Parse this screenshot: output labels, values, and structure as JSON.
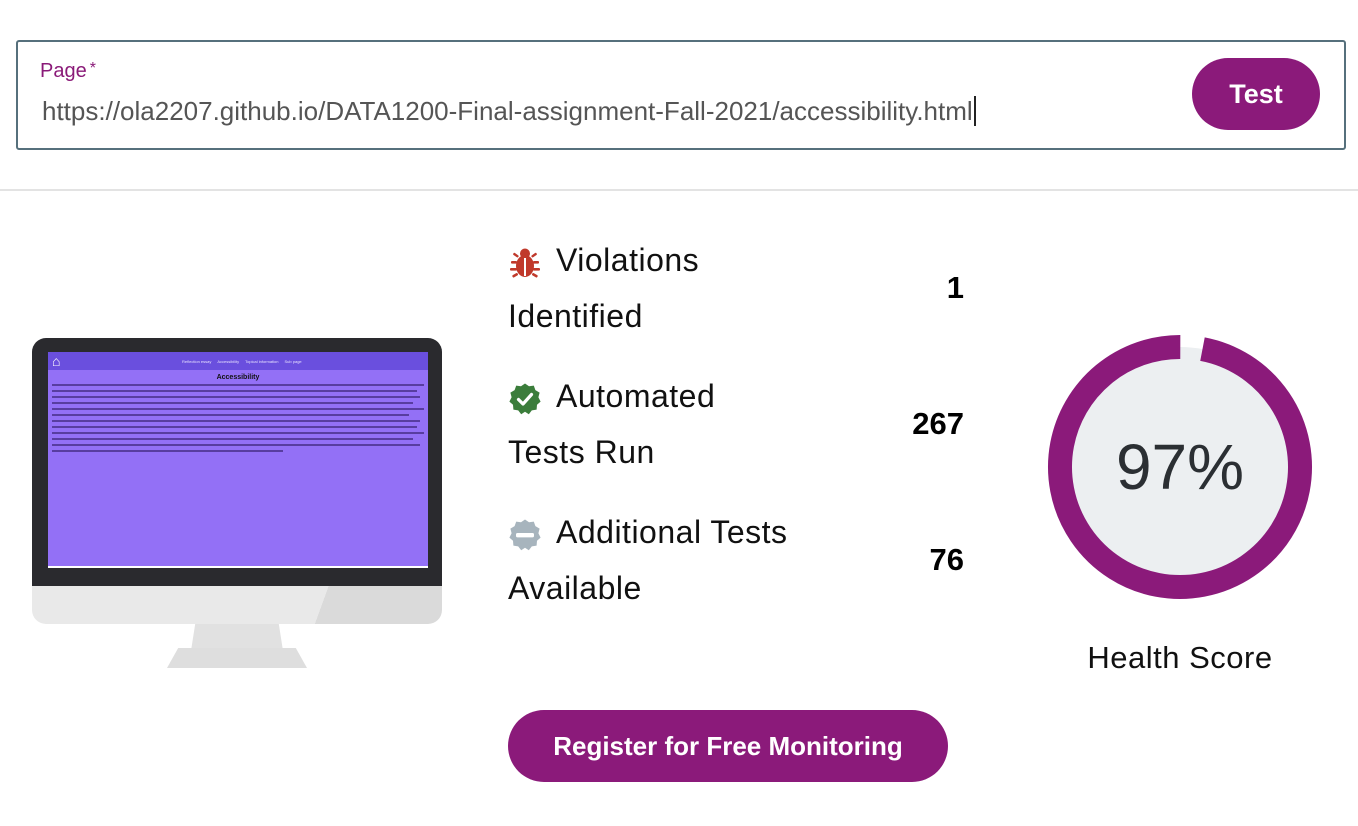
{
  "url_form": {
    "label": "Page",
    "required_marker": "*",
    "value": "https://ola2207.github.io/DATA1200-Final-assignment-Fall-2021/accessibility.html",
    "test_button_label": "Test"
  },
  "preview": {
    "nav_links": [
      "Reflection essay",
      "Accessibility",
      "Topical information",
      "Sub page"
    ],
    "title": "Accessibility",
    "home_icon": "home-icon"
  },
  "stats": [
    {
      "icon": "bug-icon",
      "line1": "Violations",
      "line2": "Identified",
      "value": "1"
    },
    {
      "icon": "check-badge-icon",
      "line1": "Automated",
      "line2": "Tests Run",
      "value": "267"
    },
    {
      "icon": "minus-badge-icon",
      "line1": "Additional Tests",
      "line2": "Available",
      "value": "76"
    }
  ],
  "health": {
    "score": 97,
    "score_text": "97%",
    "label": "Health Score"
  },
  "register_button_label": "Register for Free Monitoring",
  "colors": {
    "brand": "#8b1a7a",
    "gauge_track": "#eceff1",
    "violation": "#c0392b",
    "passed": "#3b7d3b",
    "neutral": "#a7b4bd",
    "preview_screen": "#9370f6"
  }
}
